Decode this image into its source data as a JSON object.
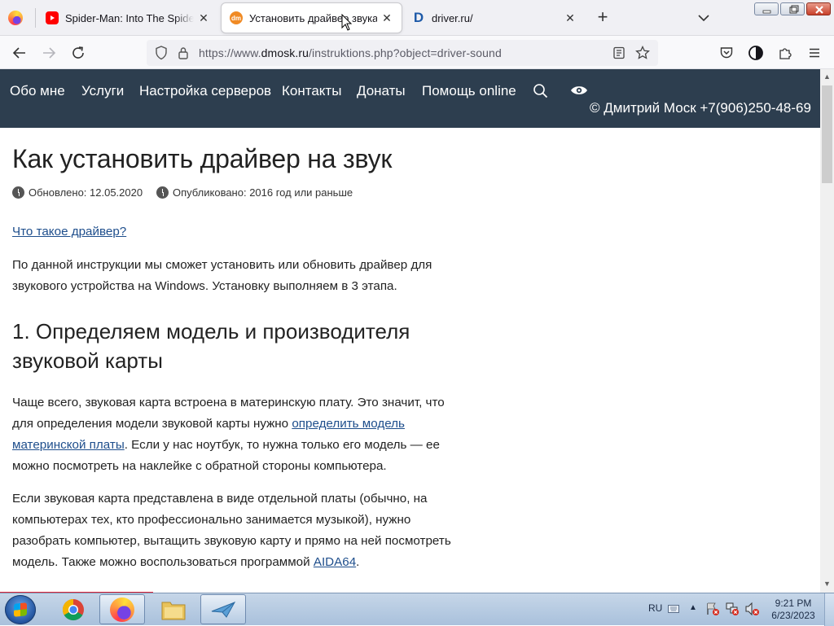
{
  "browser": {
    "tabs": [
      {
        "title": "Spider-Man: Into The Spider-Ve",
        "favicon": "youtube-icon",
        "active": false
      },
      {
        "title": "Установить драйвер звука",
        "favicon": "dmosk-icon",
        "favicon_text": "dm",
        "active": true
      },
      {
        "title": "driver.ru/",
        "favicon": "driver-d-icon",
        "favicon_text": "D",
        "active": false
      }
    ],
    "url_prefix": "https://www.",
    "url_domain": "dmosk.ru",
    "url_rest": "/instruktions.php?object=driver-sound"
  },
  "site": {
    "nav": [
      {
        "label": "Обо мне"
      },
      {
        "label": "Услуги"
      },
      {
        "label": "Настройка серверов"
      },
      {
        "label": "Контакты"
      },
      {
        "label": "Донаты"
      },
      {
        "label": "Помощь online"
      }
    ],
    "copyright": "© Дмитрий Моск  +7(906)250-48-69"
  },
  "article": {
    "title": "Как установить драйвер на звук",
    "updated": "Обновлено: 12.05.2020",
    "published": "Опубликовано: 2016 год или раньше",
    "what_is_driver_link": "Что такое драйвер?",
    "intro": "По данной инструкции мы сможет установить или обновить драйвер для звукового устройства на Windows. Установку выполняем в 3 этапа.",
    "h2": "1. Определяем модель и производителя звуковой карты",
    "p1_a": "Чаще всего, звуковая карта встроена в материнскую плату. Это значит, что для определения модели звуковой карты нужно ",
    "p1_link": "определить модель материнской платы",
    "p1_b": ". Если у нас ноутбук, то нужна только его модель — ее можно посмотреть на наклейке с обратной стороны компьютера.",
    "p2_a": "Если звуковая карта представлена в виде отдельной платы (обычно, на компьютерах тех, кто профессионально занимается музыкой), нужно разобрать компьютер, вытащить звуковую карту и прямо на ней посмотреть модель. Также можно воспользоваться программой ",
    "p2_link": "AIDA64",
    "p2_b": "."
  },
  "taskbar": {
    "lang": "RU",
    "time": "9:21 PM",
    "date": "6/23/2023"
  },
  "colors": {
    "site_header_bg": "#2d3e4f",
    "link": "#1e4e8c",
    "dmosk_favicon": "#f08a24",
    "driver_favicon": "#1e5aa8",
    "youtube_red": "#ff0000"
  }
}
